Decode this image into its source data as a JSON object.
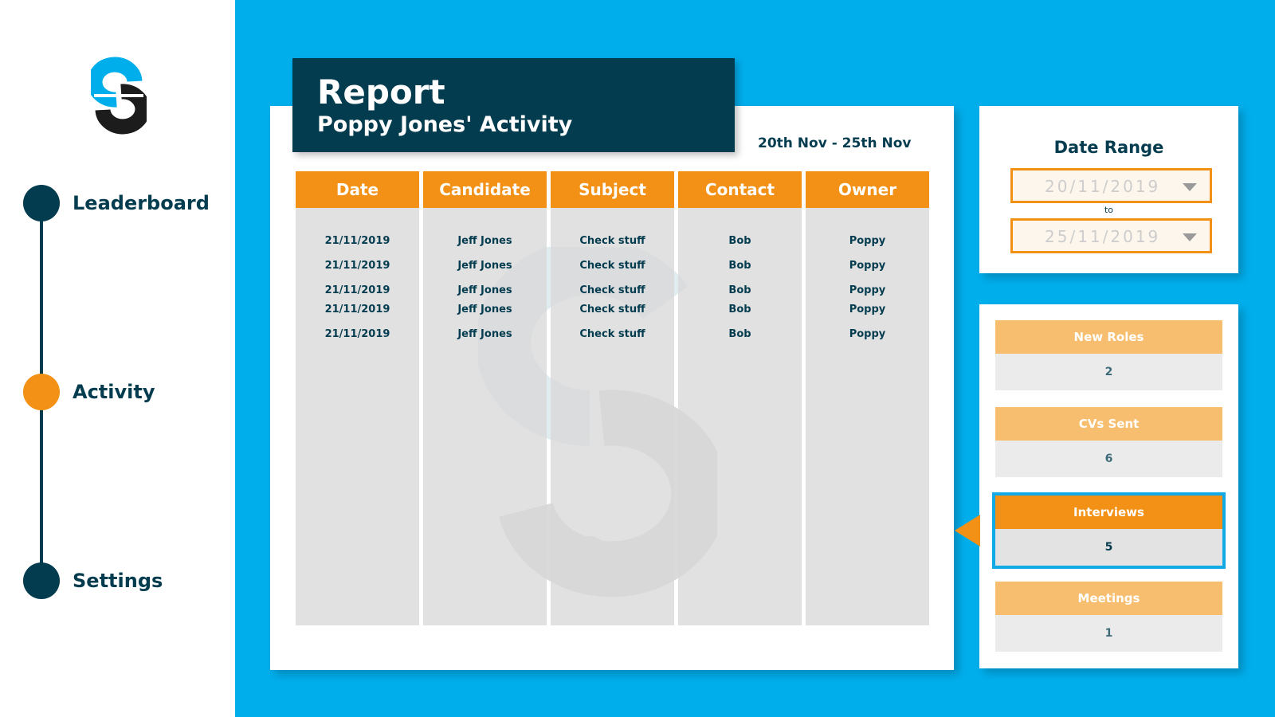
{
  "sidebar": {
    "items": [
      {
        "label": "Leaderboard",
        "active": false
      },
      {
        "label": "Activity",
        "active": true
      },
      {
        "label": "Settings",
        "active": false
      }
    ]
  },
  "report": {
    "title": "Report",
    "subtitle": "Poppy Jones' Activity",
    "date_summary": "20th Nov - 25th Nov",
    "columns": [
      "Date",
      "Candidate",
      "Subject",
      "Contact",
      "Owner"
    ],
    "rows": [
      [
        "21/11/2019",
        "Jeff Jones",
        "Check stuff",
        "Bob",
        "Poppy"
      ],
      [
        "21/11/2019",
        "Jeff Jones",
        "Check stuff",
        "Bob",
        "Poppy"
      ],
      [
        "21/11/2019",
        "Jeff Jones",
        "Check stuff",
        "Bob",
        "Poppy"
      ],
      [
        "21/11/2019",
        "Jeff Jones",
        "Check stuff",
        "Bob",
        "Poppy"
      ],
      [
        "21/11/2019",
        "Jeff Jones",
        "Check stuff",
        "Bob",
        "Poppy"
      ]
    ]
  },
  "date_range": {
    "title": "Date Range",
    "from": "20/11/2019",
    "to_label": "to",
    "to": "25/11/2019"
  },
  "stats": [
    {
      "label": "New Roles",
      "value": "2"
    },
    {
      "label": "CVs Sent",
      "value": "6"
    },
    {
      "label": "Interviews",
      "value": "5"
    },
    {
      "label": "Meetings",
      "value": "1"
    }
  ],
  "colors": {
    "brand_blue": "#00aeec",
    "navy": "#043c4f",
    "orange": "#f29116",
    "light_orange": "#f7be6f"
  }
}
